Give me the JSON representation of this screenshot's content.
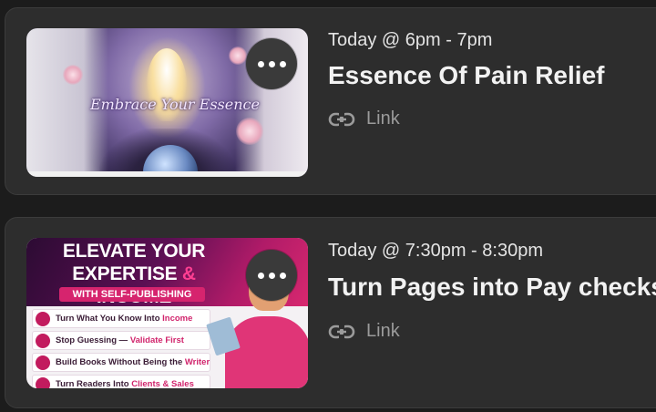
{
  "events": [
    {
      "time": "Today @ 6pm - 7pm",
      "title": "Essence Of Pain Relief",
      "link_label": "Link",
      "thumbnail": {
        "caption": "Embrace Your Essence"
      }
    },
    {
      "time": "Today @ 7:30pm - 8:30pm",
      "title": "Turn Pages into Pay checks",
      "link_label": "Link",
      "thumbnail": {
        "headline_1": "ELEVATE YOUR",
        "headline_2a": "EXPERTISE",
        "headline_amp": "&",
        "headline_2b": "INCOME",
        "subline": "WITH SELF-PUBLISHING",
        "bullets": [
          {
            "text": "Turn What You Know Into ",
            "highlight": "Income"
          },
          {
            "text": "Stop Guessing — ",
            "highlight": "Validate First"
          },
          {
            "text": "Build Books Without Being the ",
            "highlight": "Writer"
          },
          {
            "text": "Turn Readers Into ",
            "highlight": "Clients & Sales"
          }
        ]
      }
    }
  ],
  "icons": {
    "more": "more-horizontal-icon",
    "link": "link-icon"
  }
}
